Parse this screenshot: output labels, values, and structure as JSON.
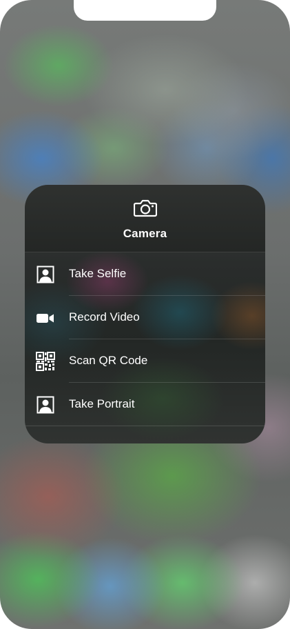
{
  "quick_actions": {
    "app_name": "Camera",
    "app_icon": "camera-icon",
    "items": [
      {
        "label": "Take Selfie",
        "icon": "portrait-frame-icon"
      },
      {
        "label": "Record Video",
        "icon": "video-camera-icon"
      },
      {
        "label": "Scan QR Code",
        "icon": "qr-code-icon"
      },
      {
        "label": "Take Portrait",
        "icon": "portrait-frame-icon"
      }
    ]
  },
  "colors": {
    "text": "#ffffff",
    "menu_background": "#2a2d2c"
  }
}
